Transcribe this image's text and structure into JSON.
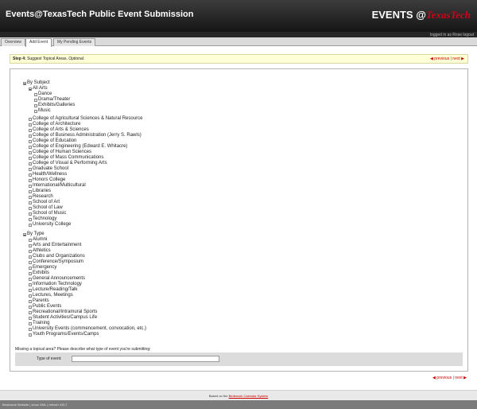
{
  "header": {
    "title": "Events@TexasTech Public Event Submission",
    "logo_prefix": "EVENTS @",
    "logo_accent": "TexasTech"
  },
  "user": {
    "login_status": "logged in as Rose logout"
  },
  "tabs": [
    {
      "label": "Overview"
    },
    {
      "label": "Add Event"
    },
    {
      "label": "My Pending Events"
    }
  ],
  "step": {
    "label": "Step 4:",
    "text": "Suggest Topical Areas.",
    "optional": "Optional."
  },
  "nav": {
    "previous": "previous",
    "next": "next",
    "separator": "|"
  },
  "tree": {
    "by_subject": "By Subject",
    "all_arts": "All Arts",
    "arts_children": [
      "Dance",
      "Drama/Theater",
      "Exhibits/Galleries",
      "Music"
    ],
    "subjects": [
      "College of Agricultural Sciences & Natural Resource",
      "College of Architecture",
      "College of Arts & Sciences",
      "College of Business Administration (Jerry S. Rawls)",
      "College of Education",
      "College of Engineering (Edward E. Whitacre)",
      "College of Human Sciences",
      "College of Mass Communications",
      "College of Visual & Performing Arts",
      "Graduate School",
      "Health/Wellness",
      "Honors College",
      "International/Multicultural",
      "Libraries",
      "Research",
      "School of Art",
      "School of Law",
      "School of Music",
      "Technology",
      "University College"
    ],
    "by_type": "By Type",
    "types": [
      "Alumni",
      "Arts and Entertainment",
      "Athletics",
      "Clubs and Organizations",
      "Conference/Symposium",
      "Emergency",
      "Exhibits",
      "General Announcements",
      "Information Technology",
      "Lecture/Reading/Talk",
      "Lectures, Meetings",
      "Parents",
      "Public Events",
      "Recreational/Intramural Sports",
      "Student Activities/Campus Life",
      "Training",
      "University Events (commencement, convocation, etc.)",
      "Youth Programs/Events/Camps"
    ]
  },
  "missing": {
    "prompt": "Missing a topical area? Please describe what type of event you're submitting:",
    "type_label": "Type of event:",
    "type_value": ""
  },
  "footer": {
    "prefix": "Based on the",
    "link": "Bedework Calendar System"
  },
  "status_bar": {
    "text": "Bedework Website | show XML | refresh XSLT"
  }
}
